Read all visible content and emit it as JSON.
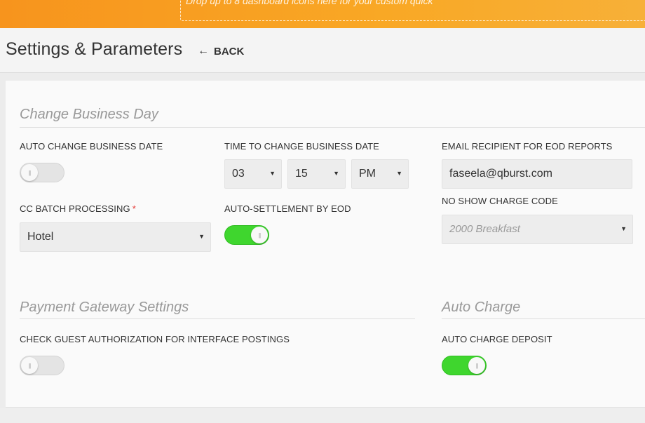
{
  "topbar": {
    "dropzone_text": "Drop up to 8 dashboard icons here for your custom quick"
  },
  "header": {
    "title": "Settings & Parameters",
    "back_label": "BACK",
    "back_icon": "arrow-left-icon"
  },
  "sections": {
    "change_business_day": {
      "title": "Change Business Day",
      "auto_change": {
        "label": "AUTO CHANGE BUSINESS DATE",
        "state": "off"
      },
      "time_to_change": {
        "label": "TIME TO CHANGE BUSINESS DATE",
        "hour": "03",
        "minute": "15",
        "meridiem": "PM"
      },
      "email_recipient": {
        "label": "EMAIL RECIPIENT FOR EOD REPORTS",
        "value": "faseela@qburst.com"
      },
      "cc_batch": {
        "label": "CC BATCH PROCESSING",
        "required_mark": "*",
        "value": "Hotel"
      },
      "auto_settlement": {
        "label": "AUTO-SETTLEMENT BY EOD",
        "state": "on"
      },
      "no_show_charge": {
        "label": "NO SHOW CHARGE CODE",
        "value": "2000 Breakfast"
      }
    },
    "payment_gateway": {
      "title": "Payment Gateway Settings",
      "check_guest_auth": {
        "label": "CHECK GUEST AUTHORIZATION FOR INTERFACE POSTINGS",
        "state": "off"
      }
    },
    "auto_charge": {
      "title": "Auto Charge",
      "auto_charge_deposit": {
        "label": "AUTO CHARGE DEPOSIT",
        "state": "on"
      }
    }
  },
  "colors": {
    "accent_orange": "#f7941d",
    "toggle_on": "#3fd62e",
    "toggle_off": "#e4e4e4",
    "required": "#e53935"
  }
}
